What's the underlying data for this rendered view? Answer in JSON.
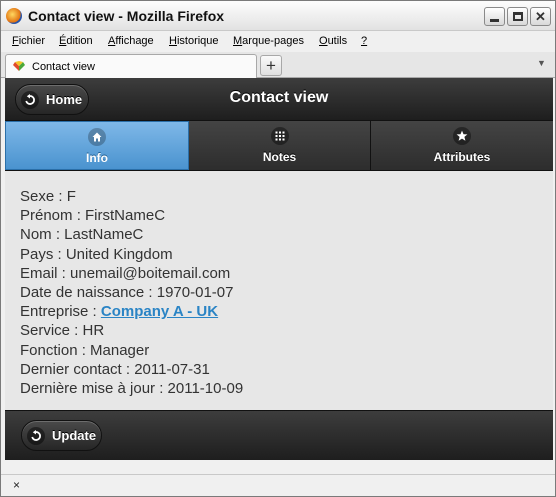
{
  "window": {
    "title": "Contact view - Mozilla Firefox"
  },
  "menu": [
    {
      "key": "F",
      "rest": "ichier"
    },
    {
      "key": "É",
      "rest": "dition"
    },
    {
      "key": "A",
      "rest": "ffichage"
    },
    {
      "key": "H",
      "rest": "istorique"
    },
    {
      "key": "M",
      "rest": "arque-pages"
    },
    {
      "key": "O",
      "rest": "utils"
    },
    {
      "key": "?",
      "rest": ""
    }
  ],
  "browser_tab": {
    "title": "Contact view",
    "new_tab": "+"
  },
  "header": {
    "home_label": "Home",
    "title": "Contact view"
  },
  "navbar": [
    {
      "label": "Info",
      "icon": "home-icon",
      "active": true
    },
    {
      "label": "Notes",
      "icon": "grid-icon",
      "active": false
    },
    {
      "label": "Attributes",
      "icon": "star-icon",
      "active": false
    }
  ],
  "contact": {
    "sexe": "Sexe : F",
    "prenom": "Prénom : FirstNameC",
    "nom": "Nom : LastNameC",
    "pays": "Pays : United Kingdom",
    "email": "Email : unemail@boitemail.com",
    "naissance": "Date de naissance : 1970-01-07",
    "entreprise_label": "Entreprise : ",
    "entreprise_link": "Company A - UK",
    "service": "Service : HR",
    "fonction": "Fonction : Manager",
    "dernier_contact": "Dernier contact : 2011-07-31",
    "derniere_maj": "Dernière mise à jour : 2011-10-09"
  },
  "footer": {
    "update_label": "Update"
  },
  "status": {
    "close": "×"
  },
  "colors": {
    "active_tab": "#5a9fd6",
    "link": "#2a84c5",
    "bar_dark": "#2b2b2b"
  }
}
